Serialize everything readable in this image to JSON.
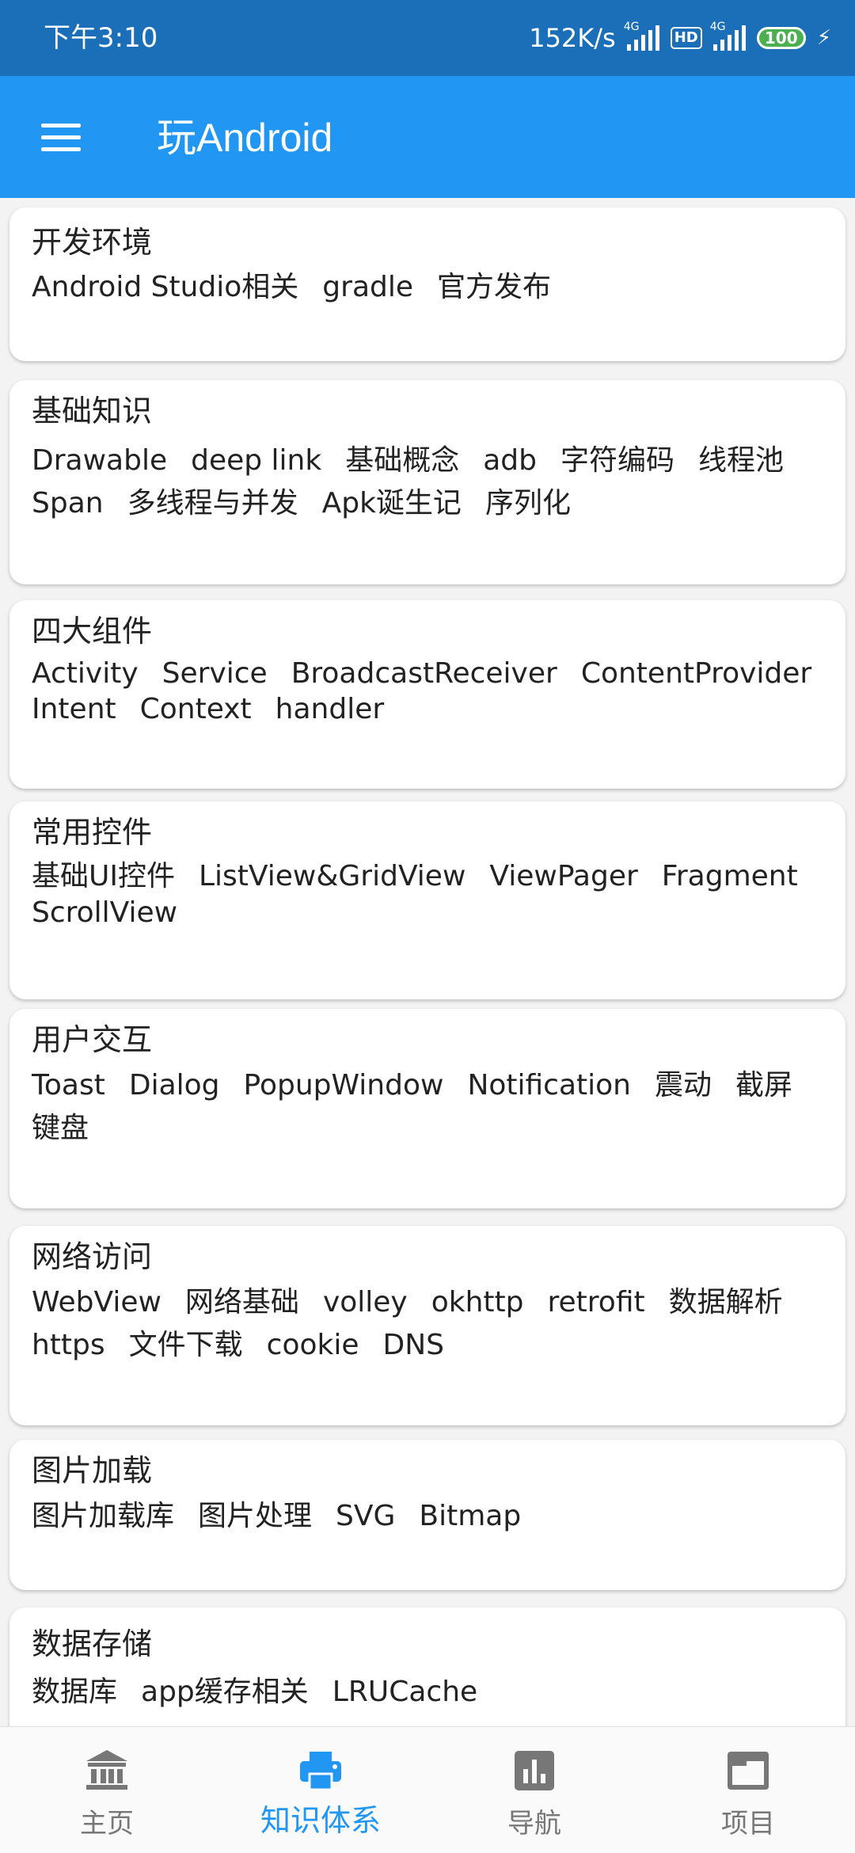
{
  "status_bar": {
    "time": "下午3:10",
    "net_speed": "152K/s",
    "signal1_label": "4G",
    "hd_label": "HD",
    "signal2_label": "4G",
    "battery": "100",
    "charging_icon": "lightning-icon"
  },
  "app_bar": {
    "menu_icon": "hamburger-menu-icon",
    "title": "玩Android",
    "color": "#2196f3"
  },
  "cards": [
    {
      "title": "开发环境",
      "tags": [
        "Android Studio相关",
        "gradle",
        "官方发布"
      ]
    },
    {
      "title": "基础知识",
      "tags": [
        "Drawable",
        "deep link",
        "基础概念",
        "adb",
        "字符编码",
        "线程池",
        "Span",
        "多线程与并发",
        "Apk诞生记",
        "序列化"
      ]
    },
    {
      "title": "四大组件",
      "tags": [
        "Activity",
        "Service",
        "BroadcastReceiver",
        "ContentProvider",
        "Intent",
        "Context",
        "handler"
      ]
    },
    {
      "title": "常用控件",
      "tags": [
        "基础UI控件",
        "ListView&GridView",
        "ViewPager",
        "Fragment",
        "ScrollView"
      ]
    },
    {
      "title": "用户交互",
      "tags": [
        "Toast",
        "Dialog",
        "PopupWindow",
        "Notification",
        "震动",
        "截屏",
        "键盘"
      ]
    },
    {
      "title": "网络访问",
      "tags": [
        "WebView",
        "网络基础",
        "volley",
        "okhttp",
        "retrofit",
        "数据解析",
        "https",
        "文件下载",
        "cookie",
        "DNS"
      ]
    },
    {
      "title": "图片加载",
      "tags": [
        "图片加载库",
        "图片处理",
        "SVG",
        "Bitmap"
      ]
    },
    {
      "title": "数据存储",
      "tags": [
        "数据库",
        "app缓存相关",
        "LRUCache"
      ]
    }
  ],
  "bottom_nav": [
    {
      "label": "主页",
      "icon": "bank-icon",
      "active": false
    },
    {
      "label": "知识体系",
      "icon": "printer-icon",
      "active": true
    },
    {
      "label": "导航",
      "icon": "bar-chart-icon",
      "active": false
    },
    {
      "label": "项目",
      "icon": "folder-tab-icon",
      "active": false
    }
  ],
  "colors": {
    "status_bar": "#1b6fb8",
    "accent": "#2196f3",
    "inactive": "#777777"
  }
}
